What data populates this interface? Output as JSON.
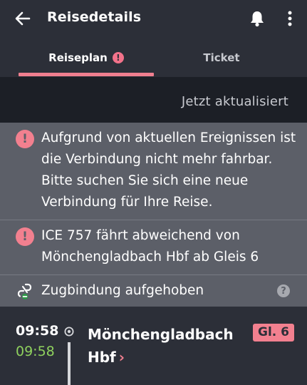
{
  "header": {
    "title": "Reisedetails",
    "back_icon": "arrow-left-icon",
    "bell_icon": "bell-icon",
    "more_icon": "more-vertical-icon"
  },
  "tabs": [
    {
      "label": "Reiseplan",
      "active": true,
      "alert_glyph": "!"
    },
    {
      "label": "Ticket",
      "active": false
    }
  ],
  "status": {
    "text": "Jetzt aktualisiert"
  },
  "notices": [
    {
      "icon": "alert-circle-icon",
      "glyph": "!",
      "text": "Aufgrund von aktuellen Ereignissen ist die Verbindung nicht mehr fahrbar. Bitte suchen Sie sich eine neue Verbindung für Ihre Reise."
    },
    {
      "icon": "alert-circle-icon",
      "glyph": "!",
      "text": "ICE 757 fährt abweichend von Mönchengladbach Hbf ab Gleis 6"
    },
    {
      "icon": "broken-link-icon",
      "text": "Zugbindung aufgehoben",
      "help_glyph": "?"
    }
  ],
  "stop": {
    "scheduled_time": "09:58",
    "actual_time": "09:58",
    "station": "Mönchengladbach Hbf",
    "chevron": "›",
    "platform": "Gl. 6"
  },
  "colors": {
    "background": "#2c2f38",
    "accent": "#f07f8f",
    "on_time": "#8fd15e",
    "notice_bg": "#5c5f68",
    "status_band": "#1c1f26"
  }
}
